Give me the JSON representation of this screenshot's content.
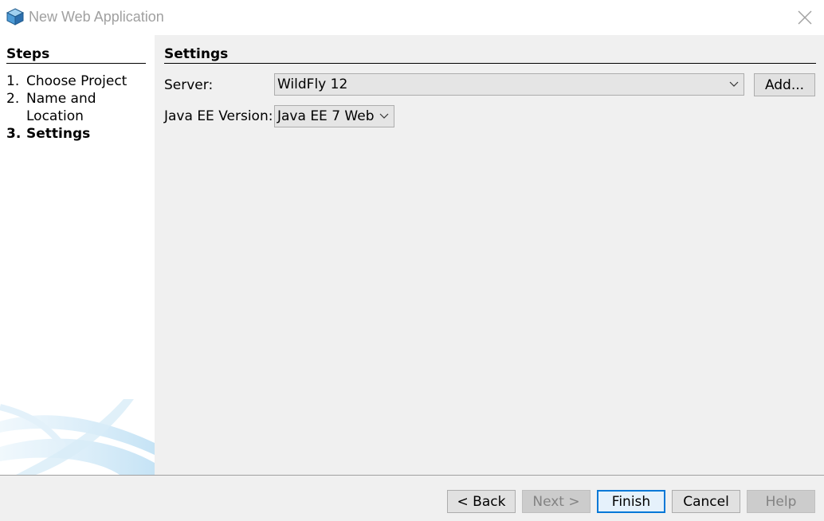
{
  "window": {
    "title": "New Web Application"
  },
  "steps": {
    "heading": "Steps",
    "items": [
      {
        "num": "1.",
        "label": "Choose Project",
        "current": false
      },
      {
        "num": "2.",
        "label": "Name and Location",
        "current": false
      },
      {
        "num": "3.",
        "label": "Settings",
        "current": true
      }
    ]
  },
  "settings": {
    "heading": "Settings",
    "server_label": "Server:",
    "server_value": "WildFly 12",
    "add_label": "Add...",
    "javaee_label": "Java EE Version:",
    "javaee_value": "Java EE 7 Web"
  },
  "buttons": {
    "back": "< Back",
    "next": "Next >",
    "finish": "Finish",
    "cancel": "Cancel",
    "help": "Help"
  },
  "icons": {
    "app": "netbeans-cube-icon",
    "close": "close-icon",
    "dropdown": "chevron-down-icon"
  },
  "colors": {
    "panel_bg": "#f0f0f0",
    "default_button_border": "#0078d7",
    "title_text": "#a0a0a0",
    "disabled_text": "#838383"
  }
}
